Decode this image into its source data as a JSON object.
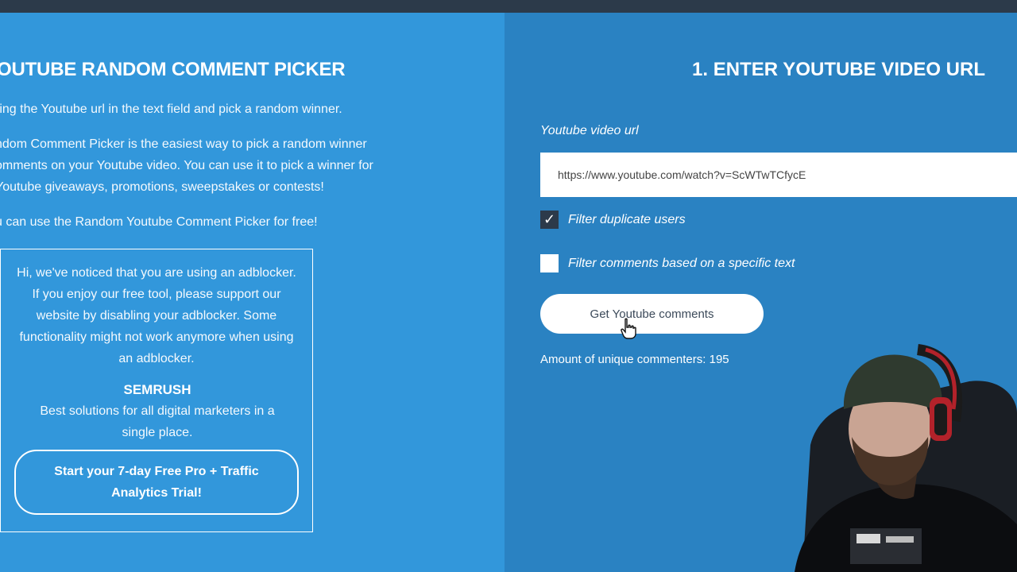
{
  "left": {
    "title": "OUTUBE RANDOM COMMENT PICKER",
    "paragraphs": [
      "ring the Youtube url in the text field and pick a random winner.",
      "ndom Comment Picker is the easiest way to pick a random winner",
      "omments on your Youtube video. You can use it to pick a winner for",
      " Youtube giveaways, promotions, sweepstakes or contests!",
      "u can use the Random Youtube Comment Picker for free!"
    ],
    "adbox": {
      "notice": "Hi, we've noticed that you are using an adblocker. If you enjoy our free tool, please support our website by disabling your adblocker. Some functionality might not work anymore when using an adblocker.",
      "brand": "SEMRUSH",
      "tagline": "Best solutions for all digital marketers in a single place.",
      "button_label": "Start your 7-day Free Pro + Traffic Analytics Trial!"
    }
  },
  "right": {
    "title": "1. ENTER YOUTUBE VIDEO URL",
    "url_label": "Youtube video url",
    "url_value": "https://www.youtube.com/watch?v=ScWTwTCfycE",
    "filter_duplicate_label": "Filter duplicate users",
    "filter_duplicate_checked": true,
    "filter_text_label": "Filter comments based on a specific text",
    "filter_text_checked": false,
    "get_button_label": "Get Youtube comments",
    "amount_text": "Amount of unique commenters: 195"
  },
  "colors": {
    "left_bg": "#3297db",
    "right_bg": "#2a82c2",
    "topbar": "#2c3a4a"
  },
  "icons": [
    "checkmark-icon",
    "hand-cursor-icon"
  ]
}
